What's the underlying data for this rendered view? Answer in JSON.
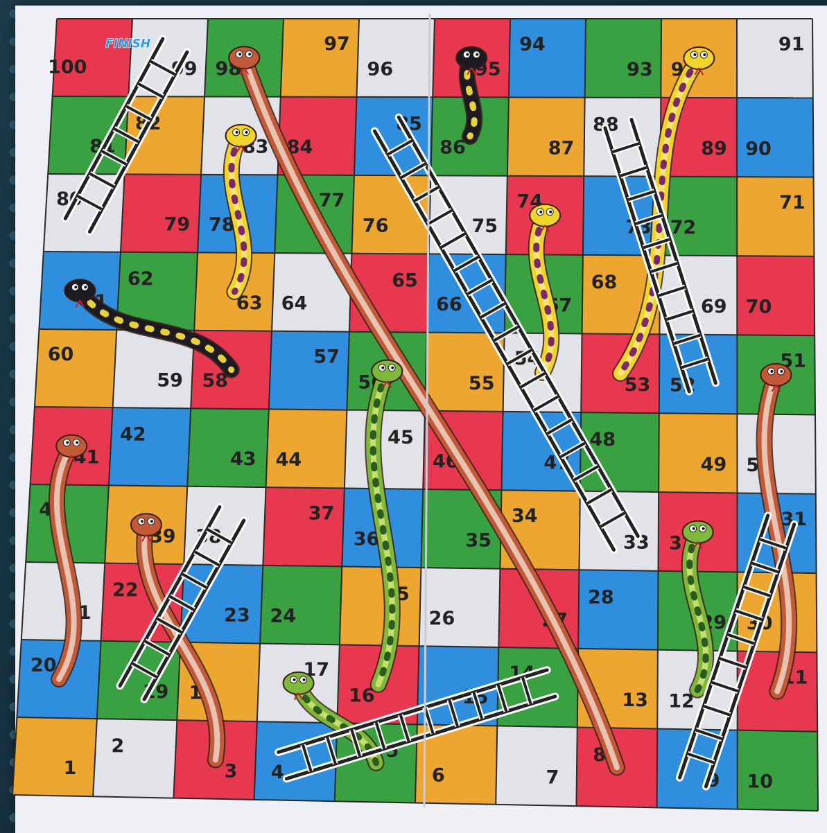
{
  "board": {
    "finish_label": "FINISH",
    "size": 10,
    "colors": {
      "red": "#e8384f",
      "gray": "#e2e3e8",
      "green": "#3aa142",
      "orange": "#eda630",
      "blue": "#2f8fde",
      "grid_line": "#2a2a2a",
      "ladder": "#222222",
      "board_paper": "#eef0f6"
    },
    "rows": [
      [
        "red",
        "gray",
        "green",
        "orange",
        "gray",
        "red",
        "blue",
        "green",
        "orange",
        "gray"
      ],
      [
        "green",
        "orange",
        "gray",
        "red",
        "blue",
        "green",
        "orange",
        "gray",
        "red",
        "blue"
      ],
      [
        "gray",
        "red",
        "blue",
        "green",
        "orange",
        "gray",
        "red",
        "blue",
        "green",
        "orange"
      ],
      [
        "blue",
        "green",
        "orange",
        "gray",
        "red",
        "blue",
        "green",
        "orange",
        "gray",
        "red"
      ],
      [
        "orange",
        "gray",
        "red",
        "blue",
        "green",
        "orange",
        "gray",
        "red",
        "blue",
        "green"
      ],
      [
        "red",
        "blue",
        "green",
        "orange",
        "gray",
        "red",
        "blue",
        "green",
        "orange",
        "gray"
      ],
      [
        "green",
        "orange",
        "gray",
        "red",
        "blue",
        "green",
        "orange",
        "gray",
        "red",
        "blue"
      ],
      [
        "gray",
        "red",
        "blue",
        "green",
        "orange",
        "gray",
        "red",
        "blue",
        "green",
        "orange"
      ],
      [
        "blue",
        "green",
        "orange",
        "gray",
        "red",
        "blue",
        "green",
        "orange",
        "gray",
        "red"
      ],
      [
        "orange",
        "gray",
        "red",
        "blue",
        "green",
        "orange",
        "gray",
        "red",
        "blue",
        "green"
      ]
    ],
    "numbers": [
      [
        100,
        99,
        98,
        97,
        96,
        95,
        94,
        93,
        92,
        91
      ],
      [
        81,
        82,
        83,
        84,
        85,
        86,
        87,
        88,
        89,
        90
      ],
      [
        80,
        79,
        78,
        77,
        76,
        75,
        74,
        73,
        72,
        71
      ],
      [
        61,
        62,
        63,
        64,
        65,
        66,
        67,
        68,
        69,
        70
      ],
      [
        60,
        59,
        58,
        57,
        56,
        55,
        54,
        53,
        52,
        51
      ],
      [
        41,
        42,
        43,
        44,
        45,
        46,
        47,
        48,
        49,
        50
      ],
      [
        40,
        39,
        38,
        37,
        36,
        35,
        34,
        33,
        32,
        31
      ],
      [
        21,
        22,
        23,
        24,
        25,
        26,
        27,
        28,
        29,
        30
      ],
      [
        20,
        19,
        18,
        17,
        16,
        15,
        14,
        13,
        12,
        11
      ],
      [
        1,
        2,
        3,
        4,
        5,
        6,
        7,
        8,
        9,
        10
      ]
    ],
    "ladders": [
      {
        "from": 19,
        "to": 38
      },
      {
        "from": 4,
        "to": 14
      },
      {
        "from": 9,
        "to": 31
      },
      {
        "from": 33,
        "to": 85
      },
      {
        "from": 52,
        "to": 88
      },
      {
        "from": 80,
        "to": 99
      }
    ],
    "snakes": [
      {
        "head": 98,
        "tail": 8,
        "color": "#c25a3a",
        "belly": "#f3ddd0",
        "spots": "none"
      },
      {
        "head": 95,
        "tail": 86,
        "color": "#1e1a22",
        "belly": "#1e1a22",
        "spots": "#e8d23a"
      },
      {
        "head": 92,
        "tail": 53,
        "color": "#f0d42a",
        "belly": "#f7e88a",
        "spots": "#7a2a6a"
      },
      {
        "head": 83,
        "tail": 63,
        "color": "#f0d42a",
        "belly": "#f7e88a",
        "spots": "#7a2a6a"
      },
      {
        "head": 74,
        "tail": 54,
        "color": "#f0d42a",
        "belly": "#f7e88a",
        "spots": "#7a2a6a"
      },
      {
        "head": 61,
        "tail": 58,
        "color": "#1e1a22",
        "belly": "#1e1a22",
        "spots": "#e8d23a"
      },
      {
        "head": 56,
        "tail": 16,
        "color": "#7fb83a",
        "belly": "#d7ea7a",
        "spots": "#2d5a1e"
      },
      {
        "head": 41,
        "tail": 20,
        "color": "#c25a3a",
        "belly": "#f3ddd0",
        "spots": "none"
      },
      {
        "head": 39,
        "tail": 3,
        "color": "#c25a3a",
        "belly": "#f3ddd0",
        "spots": "none"
      },
      {
        "head": 51,
        "tail": 11,
        "color": "#c25a3a",
        "belly": "#f3ddd0",
        "spots": "none"
      },
      {
        "head": 32,
        "tail": 12,
        "color": "#7fb83a",
        "belly": "#d7ea7a",
        "spots": "#2d5a1e"
      },
      {
        "head": 17,
        "tail": 5,
        "color": "#7fb83a",
        "belly": "#d7ea7a",
        "spots": "#2d5a1e"
      }
    ]
  }
}
